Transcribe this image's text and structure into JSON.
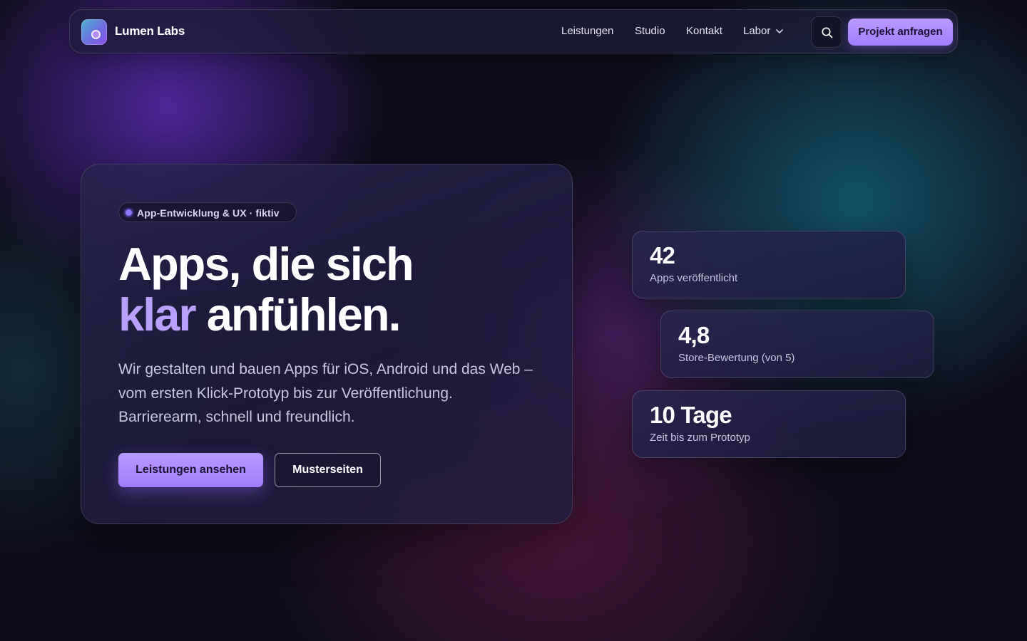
{
  "nav": {
    "brand": "Lumen Labs",
    "logo_icon": "circle-logo-icon",
    "links": [
      {
        "label": "Leistungen"
      },
      {
        "label": "Studio"
      },
      {
        "label": "Kontakt"
      },
      {
        "label": "Labor",
        "icon": "chevron-down-icon"
      }
    ],
    "search_icon": "search-icon",
    "cta_label": "Projekt anfragen"
  },
  "hero": {
    "badge": "App-Entwicklung & UX · fiktiv",
    "headline_line1": "Apps, die sich",
    "headline_accent": "klar",
    "headline_rest": "anfühlen.",
    "lead": "Wir gestalten und bauen Apps für iOS, Android und das Web – vom ersten Klick-Prototyp bis zur Veröffentlichung. Barrierearm, schnell und freundlich.",
    "primary_button": "Leistungen ansehen",
    "secondary_button": "Musterseiten"
  },
  "stats": [
    {
      "value": "42",
      "label": "Apps veröffentlicht"
    },
    {
      "value": "4,8",
      "label": "Store-Bewertung (von 5)"
    },
    {
      "value": "10 Tage",
      "label": "Zeit bis zum Prototyp"
    }
  ],
  "colors": {
    "accent": "#a98bff",
    "background": "#0f0d1c",
    "card": "#1f1c3e",
    "text_muted": "#c9c6df"
  }
}
